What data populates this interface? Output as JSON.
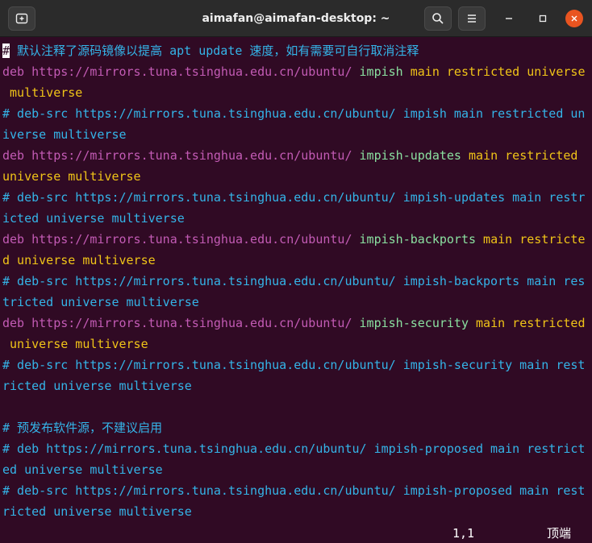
{
  "window": {
    "title": "aimafan@aimafan-desktop: ~",
    "icons": {
      "new_tab": "plus-in-box",
      "search": "magnifier",
      "menu": "hamburger",
      "minimize": "dash",
      "maximize": "square",
      "close": "x"
    },
    "colors": {
      "background": "#300a24",
      "titlebar": "#2b2b2b",
      "close_button": "#e95420",
      "comment": "#34b4e8",
      "deb_keyword": "#c35bb5",
      "url": "#c35bb5",
      "suite": "#8ae0a0",
      "components": "#f0c418"
    }
  },
  "editor": {
    "cursor_char": "#",
    "lines": [
      " 默认注释了源码镜像以提高 apt update 速度，如有需要可自行取消注释",
      "deb",
      " https://mirrors.tuna.tsinghua.edu.cn/ubuntu/ ",
      "impish",
      " main restricted universe",
      " multiverse",
      "# deb-src https://mirrors.tuna.tsinghua.edu.cn/ubuntu/ impish main restricted un",
      "iverse multiverse",
      "deb",
      " https://mirrors.tuna.tsinghua.edu.cn/ubuntu/ ",
      "impish-updates",
      " main restricted",
      "universe multiverse",
      "# deb-src https://mirrors.tuna.tsinghua.edu.cn/ubuntu/ impish-updates main restr",
      "icted universe multiverse",
      "deb",
      " https://mirrors.tuna.tsinghua.edu.cn/ubuntu/ ",
      "impish-backports",
      " main restricte",
      "d universe multiverse",
      "# deb-src https://mirrors.tuna.tsinghua.edu.cn/ubuntu/ impish-backports main res",
      "tricted universe multiverse",
      "deb",
      " https://mirrors.tuna.tsinghua.edu.cn/ubuntu/ ",
      "impish-security",
      " main restricted",
      " universe multiverse",
      "# deb-src https://mirrors.tuna.tsinghua.edu.cn/ubuntu/ impish-security main rest",
      "ricted universe multiverse",
      "# 预发布软件源，不建议启用",
      "# deb https://mirrors.tuna.tsinghua.edu.cn/ubuntu/ impish-proposed main restrict",
      "ed universe multiverse",
      "# deb-src https://mirrors.tuna.tsinghua.edu.cn/ubuntu/ impish-proposed main rest",
      "ricted universe multiverse"
    ]
  },
  "status": {
    "position": "1,1",
    "scroll": "顶端"
  }
}
